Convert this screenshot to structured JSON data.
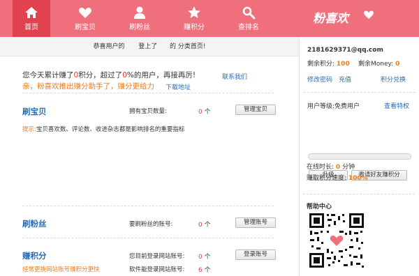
{
  "nav": {
    "items": [
      {
        "label": "首页",
        "icon": "home-icon"
      },
      {
        "label": "刷宝贝",
        "icon": "heart-icon"
      },
      {
        "label": "刷粉丝",
        "icon": "user-icon"
      },
      {
        "label": "赚积分",
        "icon": "star-icon"
      },
      {
        "label": "查排名",
        "icon": "search-icon"
      }
    ],
    "logo": "粉喜欢",
    "colors": {
      "bar": "#ef6f7d",
      "active": "#e2414f"
    }
  },
  "banner": {
    "pre": "恭喜用户的",
    "mid": "登上了",
    "post": "的",
    "cat": "分类首页!"
  },
  "summary": {
    "p1": "您今天累计赚了",
    "points": "0",
    "p2": "积分，超过了",
    "percent": "0",
    "p3": "%的用户，再接再厉!",
    "contact": "联系我们",
    "promo": "亲，粉喜欢推出赚分助手了，赚分更给力",
    "download": "下载地址"
  },
  "sections": {
    "baobei": {
      "title": "刷宝贝",
      "label": "拥有宝贝数量:",
      "count": "0",
      "unit": "个",
      "button": "管理宝贝",
      "tip_label": "提示:",
      "tip": "宝贝喜欢数、评论数、收进杂志都是影响排名的重要指标"
    },
    "fensi": {
      "title": "刷粉丝",
      "label": "要刷粉丝的账号:",
      "count": "0",
      "unit": "个",
      "button": "管理账号"
    },
    "jifen": {
      "title": "赚积分",
      "label": "您目前登录网站账号:",
      "count": "0",
      "unit": "个",
      "button": "登录账号",
      "subtitle": "经常更换网站账号赚积分更快",
      "label2": "软件能登录网站账号:",
      "count2": "6",
      "unit2": "个"
    }
  },
  "right": {
    "email": "2181629371@qq.com",
    "points_label": "剩余积分:",
    "points": "100",
    "money_label": "剩余Money:",
    "money": "0",
    "change_pwd": "修改密码",
    "recharge": "充值",
    "exchange": "积分兑换",
    "level": "用户等级:免费用户",
    "privileges": "查看特权",
    "level_progress": 0,
    "upgrade": "升级",
    "invite": "邀请好友赚积分",
    "online_label": "在线时长:",
    "online_value": "0",
    "online_unit": "分钟",
    "speed_label": "赚取积分速度:",
    "speed_value": "100%",
    "help": "帮助中心"
  }
}
